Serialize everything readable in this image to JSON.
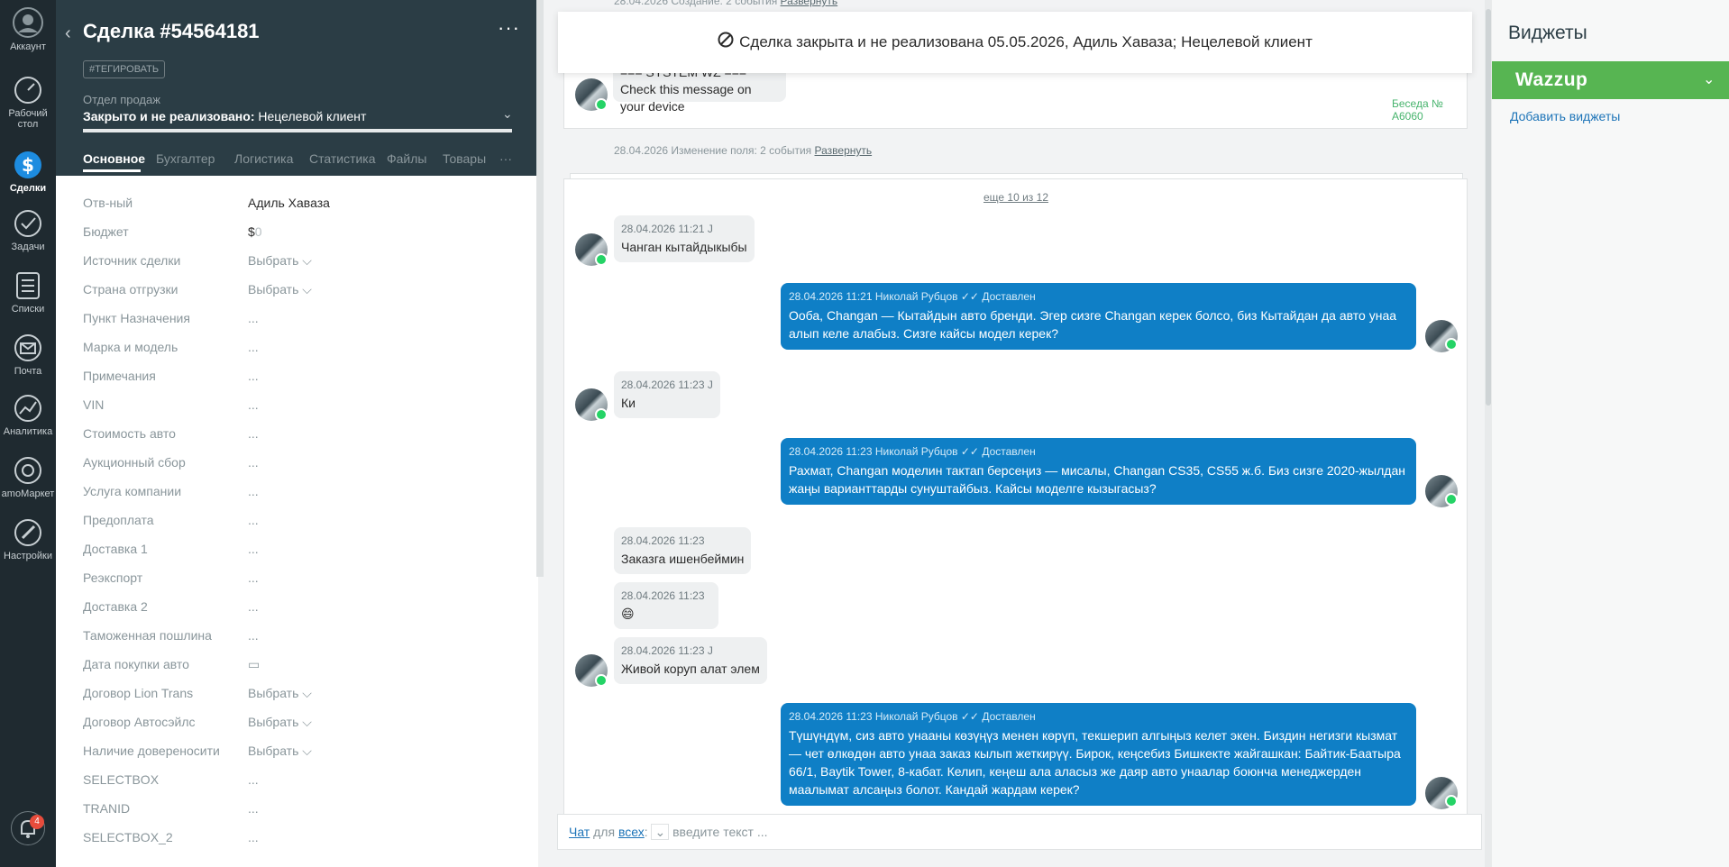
{
  "nav": {
    "items": [
      {
        "label": "Аккаунт"
      },
      {
        "label": "Рабочий стол"
      },
      {
        "label": "Сделки"
      },
      {
        "label": "Задачи"
      },
      {
        "label": "Списки"
      },
      {
        "label": "Почта"
      },
      {
        "label": "Аналитика"
      },
      {
        "label": "amoМаркет"
      },
      {
        "label": "Настройки"
      }
    ],
    "notification_count": "4"
  },
  "deal": {
    "title": "Сделка #54564181",
    "more_label": "···",
    "tag_button": "#ТЕГИРОВАТЬ",
    "pipeline": "Отдел продаж",
    "status_bold": "Закрыто и не реализовано:",
    "status_reason": " Нецелевой клиент",
    "tabs": [
      "Основное",
      "Бухгалтер",
      "Логистика",
      "Статистика",
      "Файлы",
      "Товары",
      "···"
    ],
    "fields": [
      {
        "label": "Отв-ный",
        "value": "Адиль Хаваза"
      },
      {
        "label": "Бюджет",
        "value": "$",
        "value_muted": "0"
      },
      {
        "label": "Источник сделки",
        "value": "Выбрать ⌵"
      },
      {
        "label": "Страна отгрузки",
        "value": "Выбрать ⌵"
      },
      {
        "label": "Пункт Назначения",
        "value": "..."
      },
      {
        "label": "Марка и модель",
        "value": "..."
      },
      {
        "label": "Примечания",
        "value": "..."
      },
      {
        "label": "VIN",
        "value": "..."
      },
      {
        "label": "Стоимость авто",
        "value": "..."
      },
      {
        "label": "Аукционный сбор",
        "value": "..."
      },
      {
        "label": "Услуга компании",
        "value": "..."
      },
      {
        "label": "Предоплата",
        "value": "..."
      },
      {
        "label": "Доставка 1",
        "value": "..."
      },
      {
        "label": "Реэкспорт",
        "value": "..."
      },
      {
        "label": "Доставка 2",
        "value": "..."
      },
      {
        "label": "Таможенная пошлина",
        "value": "..."
      },
      {
        "label": "Дата покупки авто",
        "value": "▭"
      },
      {
        "label": "Договор Lion Trans",
        "value": "Выбрать ⌵"
      },
      {
        "label": "Договор Автосэйлс",
        "value": "Выбрать ⌵"
      },
      {
        "label": "Наличие довереносити",
        "value": "Выбрать ⌵"
      },
      {
        "label": "SELECTBOX",
        "value": "..."
      },
      {
        "label": "TRANID",
        "value": "..."
      },
      {
        "label": "SELECTBOX_2",
        "value": "..."
      }
    ]
  },
  "feed": {
    "top_meta": "28.04.2026 Создание: 2 события",
    "top_meta_link": "Развернуть",
    "closed_banner": "Сделка закрыта и не реализована 05.05.2026, Адиль Хаваза; Нецелевой клиент",
    "system_msg": "=== SYSTEM WZ ===",
    "system_text": "Check this message on your device",
    "beseda": "Беседа № А6060",
    "change_meta": "28.04.2026 Изменение поля: 2 события",
    "change_link": "Развернуть",
    "more_link": "еще 10 из 12",
    "messages": [
      {
        "dir": "in",
        "meta": "28.04.2026 11:21 J",
        "text": "Чанган кытайдыкыбы"
      },
      {
        "dir": "out",
        "meta": "28.04.2026 11:21 Николай Рубцов  ✓✓ Доставлен",
        "text": "Ооба, Changan — Кытайдын авто бренди. Эгер сизге Changan керек болсо, биз Кытайдан да авто унаа алып келе алабыз. Сизге кайсы модел керек?"
      },
      {
        "dir": "in",
        "meta": "28.04.2026 11:23 J",
        "text": "Ки"
      },
      {
        "dir": "out",
        "meta": "28.04.2026 11:23 Николай Рубцов  ✓✓ Доставлен",
        "text": "Рахмат, Changan моделин тактап берсеңиз — мисалы, Changan CS35, CS55 ж.б. Биз сизге 2020-жылдан жаңы варианттарды сунуштайбыз. Кайсы моделге кызыгасыз?"
      },
      {
        "dir": "in",
        "meta": "28.04.2026 11:23",
        "text": "Заказга ишенбеймин"
      },
      {
        "dir": "in",
        "meta": "28.04.2026 11:23",
        "text": "😄"
      },
      {
        "dir": "in",
        "meta": "28.04.2026 11:23 J",
        "text": "Живой коруп алат элем"
      },
      {
        "dir": "out",
        "meta": "28.04.2026 11:23 Николай Рубцов  ✓✓ Доставлен",
        "text": "Түшүндүм, сиз авто унааны көзүңүз менен көрүп, текшерип алгыңыз келет экен. Биздин негизги кызмат — чет өлкөдөн авто унаа заказ кылып жеткирүү. Бирок, кеңсебиз Бишкекте жайгашкан: Байтик-Баатыра 66/1, Baytik Tower, 8-кабат. Келип, кеңеш ала аласыз же даяр авто унаалар боюнча менеджерден маалымат алсаңыз болот. Кандай жардам керек?"
      }
    ],
    "chat_label": "Чат",
    "chat_for": " для ",
    "chat_all": "всех",
    "chat_placeholder": "введите текст ..."
  },
  "widgets": {
    "title": "Виджеты",
    "wazzup": "Wazzup",
    "add": "Добавить виджеты"
  }
}
